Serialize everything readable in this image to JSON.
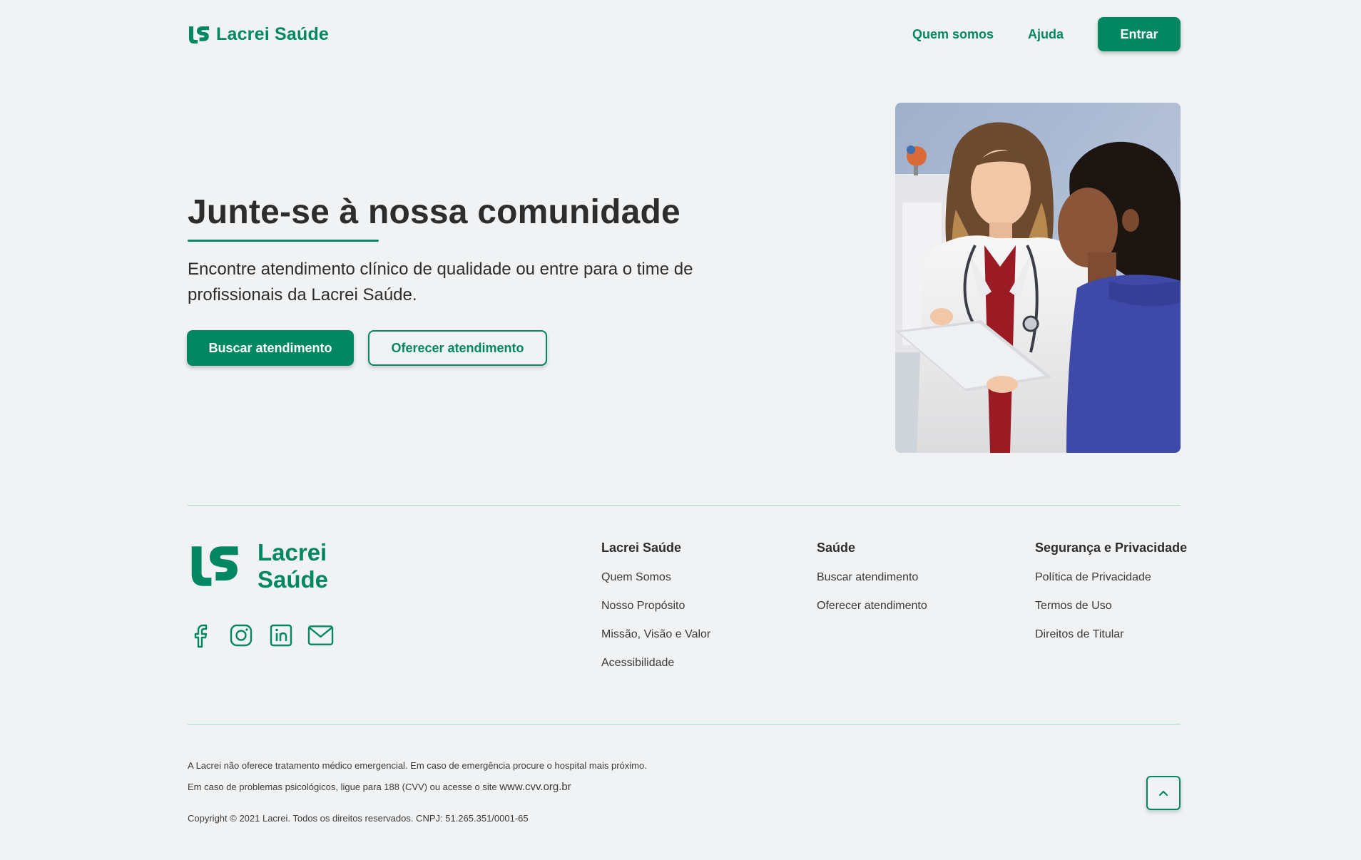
{
  "header": {
    "brand": "Lacrei Saúde",
    "nav": [
      "Quem somos",
      "Ajuda"
    ],
    "enter_label": "Entrar"
  },
  "hero": {
    "title": "Junte-se à nossa comunidade",
    "description": "Encontre atendimento clínico de qualidade ou entre para o time de profissionais da Lacrei Saúde.",
    "primary_cta": "Buscar atendimento",
    "secondary_cta": "Oferecer atendimento"
  },
  "footer": {
    "brand_line1": "Lacrei",
    "brand_line2": "Saúde",
    "socials": [
      "facebook-icon",
      "instagram-icon",
      "linkedin-icon",
      "mail-icon"
    ],
    "columns": [
      {
        "title": "Lacrei Saúde",
        "links": [
          "Quem Somos",
          "Nosso Propósito",
          "Missão, Visão e Valor",
          "Acessibilidade"
        ]
      },
      {
        "title": "Saúde",
        "links": [
          "Buscar atendimento",
          "Oferecer atendimento"
        ]
      },
      {
        "title": "Segurança e Privacidade",
        "links": [
          "Política de Privacidade",
          "Termos de Uso",
          "Direitos de Titular"
        ]
      }
    ],
    "disclaimer": "A Lacrei não oferece tratamento médico emergencial. Em caso de emergência procure o hospital mais próximo.",
    "cvv_text": "Em caso de problemas psicológicos, ligue para 188 (CVV) ou acesse o site",
    "cvv_site": "www.cvv.org.br",
    "copyright": "Copyright © 2021 Lacrei. Todos os direitos reservados. CNPJ: 51.265.351/0001-65"
  },
  "colors": {
    "brand_green": "#018762",
    "background": "#f0f2f4",
    "text": "#2d2d2d"
  }
}
